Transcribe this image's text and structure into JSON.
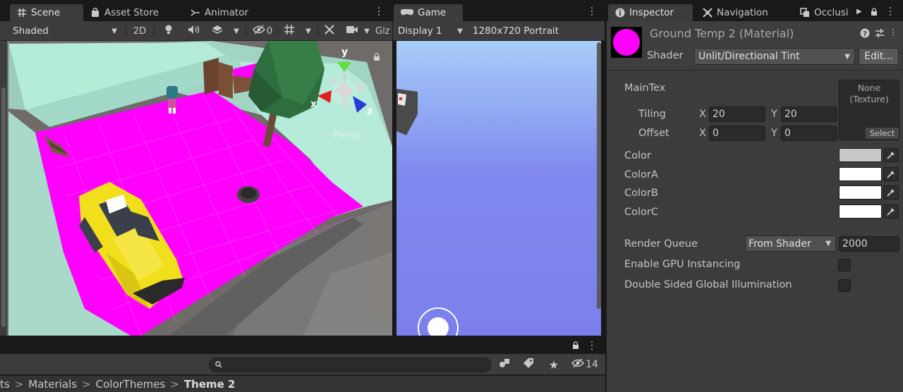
{
  "tabs": {
    "scene": "Scene",
    "asset_store": "Asset Store",
    "animator": "Animator",
    "game": "Game",
    "inspector": "Inspector",
    "navigation": "Navigation",
    "occlusion": "Occlusi"
  },
  "scene_toolbar": {
    "shading_mode": "Shaded",
    "mode_2d": "2D",
    "hidden_count": "0",
    "gizmos": "Giz"
  },
  "scene_view": {
    "gizmo_y": "y",
    "gizmo_x": "x",
    "gizmo_z": "z",
    "projection": "Persp"
  },
  "game_toolbar": {
    "display": "Display 1",
    "resolution": "1280x720 Portrait"
  },
  "inspector": {
    "material_name": "Ground Temp 2 (Material)",
    "shader_label": "Shader",
    "shader_value": "Unlit/Directional Tint",
    "edit_button": "Edit...",
    "maintex_label": "MainTex",
    "texture_none": "None",
    "texture_type": "(Texture)",
    "texture_select": "Select",
    "tiling_label": "Tiling",
    "tiling_x": "20",
    "tiling_y": "20",
    "offset_label": "Offset",
    "offset_x": "0",
    "offset_y": "0",
    "x_label": "X",
    "y_label": "Y",
    "color_label": "Color",
    "colora_label": "ColorA",
    "colorb_label": "ColorB",
    "colorc_label": "ColorC",
    "render_queue_label": "Render Queue",
    "render_queue_mode": "From Shader",
    "render_queue_value": "2000",
    "gpu_instancing_label": "Enable GPU Instancing",
    "double_sided_gi_label": "Double Sided Global Illumination"
  },
  "project": {
    "hidden_count": "14",
    "breadcrumb_1": "ts",
    "breadcrumb_2": "Materials",
    "breadcrumb_3": "ColorThemes",
    "breadcrumb_4": "Theme 2",
    "sep": ">"
  },
  "colors": {
    "material_preview": "#ff00ff",
    "color": "#c8c8c8",
    "color_a": "#ffffff",
    "color_b": "#ffffff",
    "color_c": "#ffffff",
    "ground": "#ff00ff",
    "wall": "#b4ecd8",
    "taxi": "#f2df1c",
    "sky_top": "#a7cdf8",
    "sky_bottom": "#7b80ec"
  }
}
